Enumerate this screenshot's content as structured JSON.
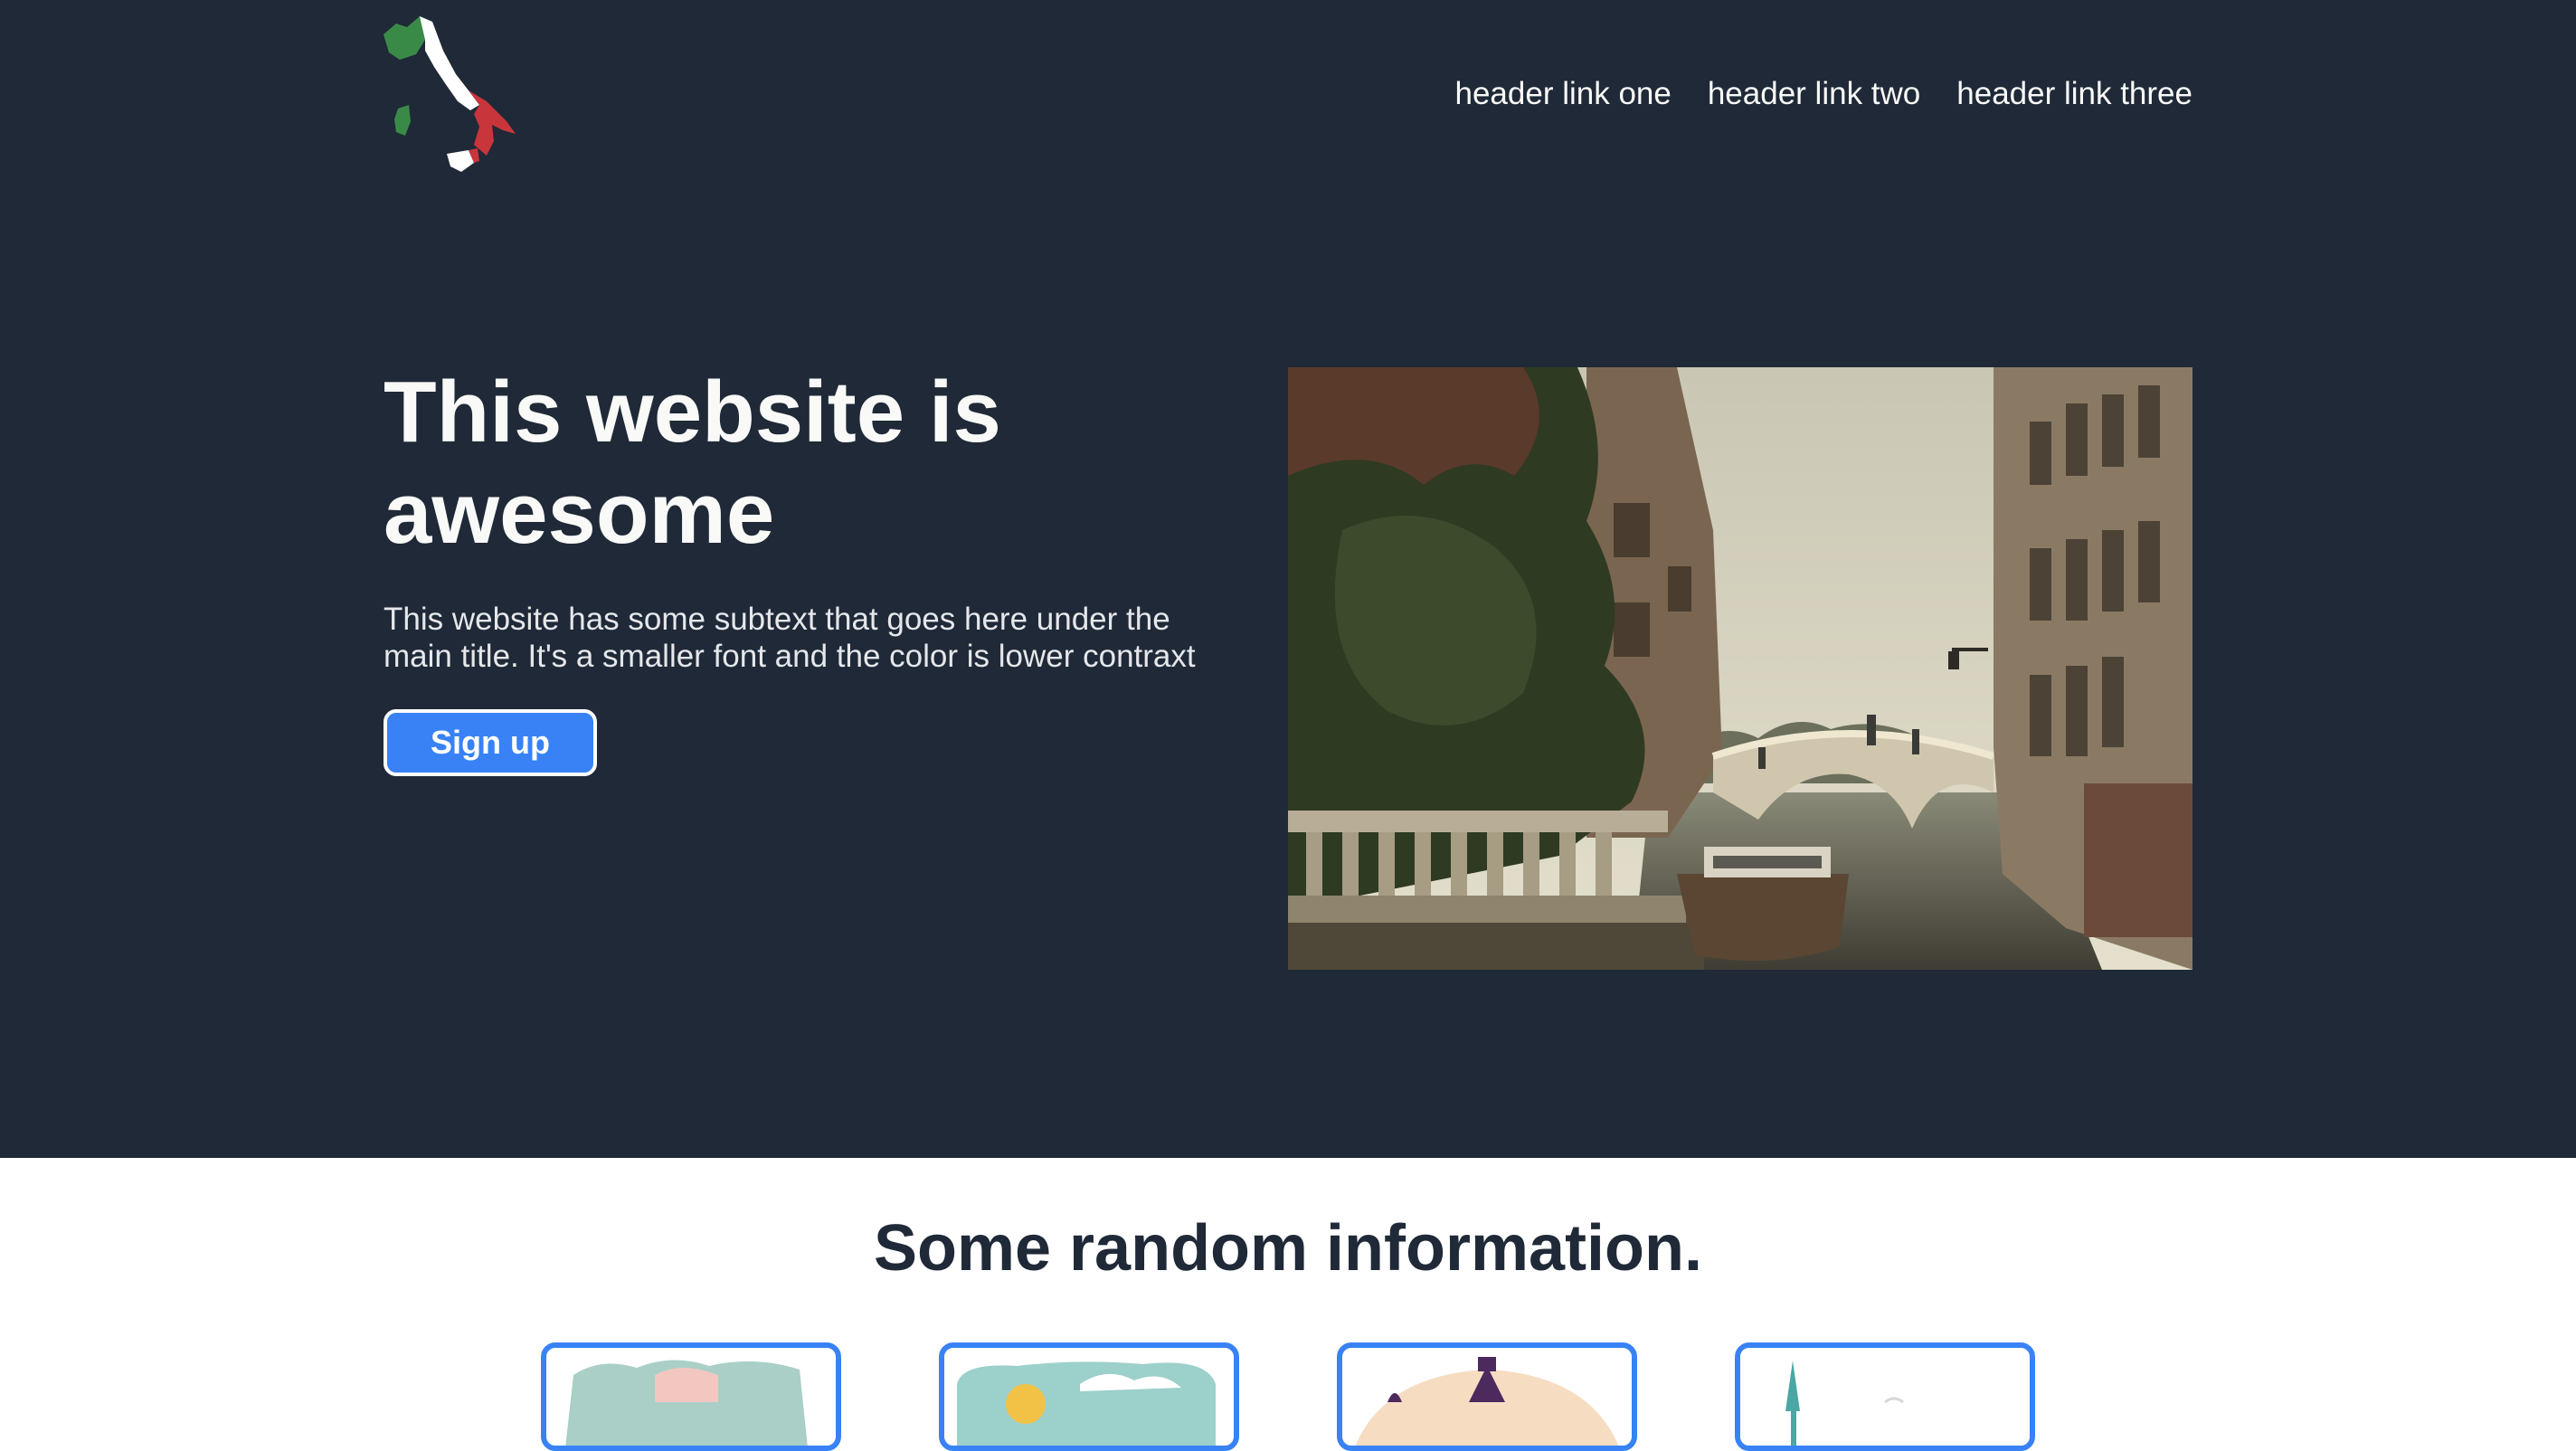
{
  "header": {
    "logo_icon": "italy-map-flag-icon",
    "nav_links": [
      "header link one",
      "header link two",
      "header link three"
    ]
  },
  "hero": {
    "title": "This website is awesome",
    "subtitle": "This website has some subtext that goes here under the main title. It's a smaller font and the color is lower contraxt",
    "cta_label": "Sign up",
    "image": "venice-canal-photo"
  },
  "info": {
    "title": "Some random information.",
    "cards": [
      {
        "image": "landscape-illustration-1"
      },
      {
        "image": "landscape-illustration-2"
      },
      {
        "image": "landscape-illustration-3"
      },
      {
        "image": "landscape-illustration-4"
      }
    ]
  },
  "colors": {
    "hero_bg": "#1f2937",
    "accent": "#3882f6",
    "light_text": "#f9faf8",
    "italy_green": "#3a8a47",
    "italy_red": "#c8353a"
  }
}
